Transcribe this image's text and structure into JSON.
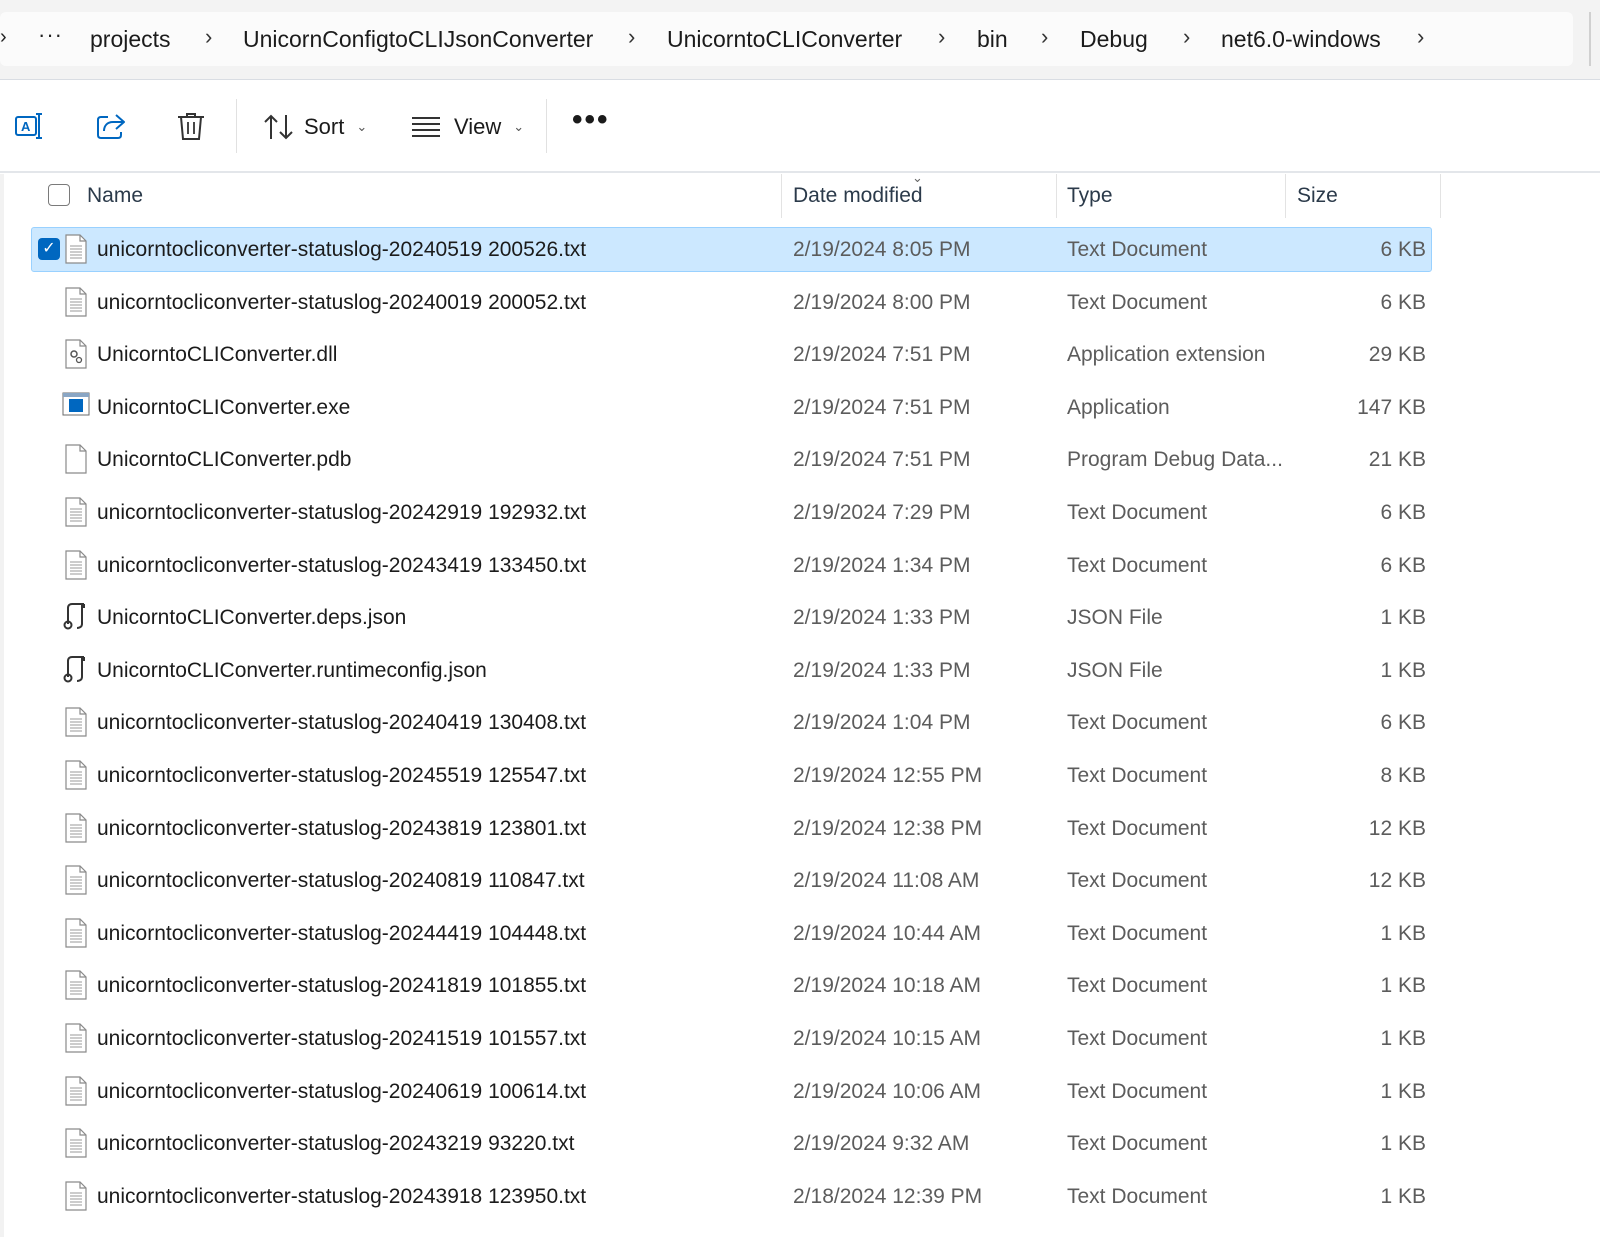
{
  "breadcrumb": {
    "lead_chevron": "›",
    "overflow": "···",
    "separator": "›",
    "items": [
      "projects",
      "UnicornConfigtoCLIJsonConverter",
      "UnicorntoCLIConverter",
      "bin",
      "Debug",
      "net6.0-windows"
    ]
  },
  "toolbar": {
    "rename_icon": "rename-icon",
    "share_icon": "share-icon",
    "delete_icon": "trash-icon",
    "sort_label": "Sort",
    "view_label": "View",
    "more_label": "•••"
  },
  "columns": {
    "name": "Name",
    "date": "Date modified",
    "type": "Type",
    "size": "Size"
  },
  "accent_color": "#0067c0",
  "selection_color": "#cce8ff",
  "files": [
    {
      "name": "unicorntocliconverter-statuslog-20240519 200526.txt",
      "date": "2/19/2024 8:05 PM",
      "type": "Text Document",
      "size": "6 KB",
      "icon": "text-file-icon",
      "selected": true
    },
    {
      "name": "unicorntocliconverter-statuslog-20240019 200052.txt",
      "date": "2/19/2024 8:00 PM",
      "type": "Text Document",
      "size": "6 KB",
      "icon": "text-file-icon"
    },
    {
      "name": "UnicorntoCLIConverter.dll",
      "date": "2/19/2024 7:51 PM",
      "type": "Application extension",
      "size": "29 KB",
      "icon": "dll-file-icon"
    },
    {
      "name": "UnicorntoCLIConverter.exe",
      "date": "2/19/2024 7:51 PM",
      "type": "Application",
      "size": "147 KB",
      "icon": "exe-file-icon"
    },
    {
      "name": "UnicorntoCLIConverter.pdb",
      "date": "2/19/2024 7:51 PM",
      "type": "Program Debug Data...",
      "size": "21 KB",
      "icon": "blank-file-icon"
    },
    {
      "name": "unicorntocliconverter-statuslog-20242919 192932.txt",
      "date": "2/19/2024 7:29 PM",
      "type": "Text Document",
      "size": "6 KB",
      "icon": "text-file-icon"
    },
    {
      "name": "unicorntocliconverter-statuslog-20243419 133450.txt",
      "date": "2/19/2024 1:34 PM",
      "type": "Text Document",
      "size": "6 KB",
      "icon": "text-file-icon"
    },
    {
      "name": "UnicorntoCLIConverter.deps.json",
      "date": "2/19/2024 1:33 PM",
      "type": "JSON File",
      "size": "1 KB",
      "icon": "json-file-icon"
    },
    {
      "name": "UnicorntoCLIConverter.runtimeconfig.json",
      "date": "2/19/2024 1:33 PM",
      "type": "JSON File",
      "size": "1 KB",
      "icon": "json-file-icon"
    },
    {
      "name": "unicorntocliconverter-statuslog-20240419 130408.txt",
      "date": "2/19/2024 1:04 PM",
      "type": "Text Document",
      "size": "6 KB",
      "icon": "text-file-icon"
    },
    {
      "name": "unicorntocliconverter-statuslog-20245519 125547.txt",
      "date": "2/19/2024 12:55 PM",
      "type": "Text Document",
      "size": "8 KB",
      "icon": "text-file-icon"
    },
    {
      "name": "unicorntocliconverter-statuslog-20243819 123801.txt",
      "date": "2/19/2024 12:38 PM",
      "type": "Text Document",
      "size": "12 KB",
      "icon": "text-file-icon"
    },
    {
      "name": "unicorntocliconverter-statuslog-20240819 110847.txt",
      "date": "2/19/2024 11:08 AM",
      "type": "Text Document",
      "size": "12 KB",
      "icon": "text-file-icon"
    },
    {
      "name": "unicorntocliconverter-statuslog-20244419 104448.txt",
      "date": "2/19/2024 10:44 AM",
      "type": "Text Document",
      "size": "1 KB",
      "icon": "text-file-icon"
    },
    {
      "name": "unicorntocliconverter-statuslog-20241819 101855.txt",
      "date": "2/19/2024 10:18 AM",
      "type": "Text Document",
      "size": "1 KB",
      "icon": "text-file-icon"
    },
    {
      "name": "unicorntocliconverter-statuslog-20241519 101557.txt",
      "date": "2/19/2024 10:15 AM",
      "type": "Text Document",
      "size": "1 KB",
      "icon": "text-file-icon"
    },
    {
      "name": "unicorntocliconverter-statuslog-20240619 100614.txt",
      "date": "2/19/2024 10:06 AM",
      "type": "Text Document",
      "size": "1 KB",
      "icon": "text-file-icon"
    },
    {
      "name": "unicorntocliconverter-statuslog-20243219 93220.txt",
      "date": "2/19/2024 9:32 AM",
      "type": "Text Document",
      "size": "1 KB",
      "icon": "text-file-icon"
    },
    {
      "name": "unicorntocliconverter-statuslog-20243918 123950.txt",
      "date": "2/18/2024 12:39 PM",
      "type": "Text Document",
      "size": "1 KB",
      "icon": "text-file-icon"
    }
  ]
}
